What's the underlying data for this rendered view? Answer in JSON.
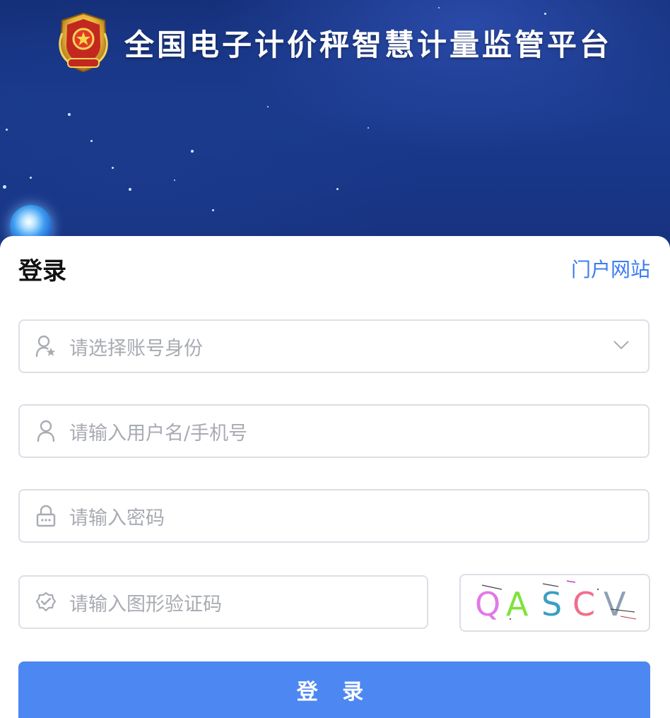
{
  "header": {
    "title": "全国电子计价秤智慧计量监管平台",
    "emblem_icon": "police-emblem-icon"
  },
  "login": {
    "title": "登录",
    "portal_link": "门户网站",
    "identity_select": {
      "placeholder": "请选择账号身份",
      "icon": "user-star-icon"
    },
    "username_field": {
      "placeholder": "请输入用户名/手机号",
      "icon": "user-icon"
    },
    "password_field": {
      "placeholder": "请输入密码",
      "icon": "lock-icon"
    },
    "captcha_field": {
      "placeholder": "请输入图形验证码",
      "icon": "verified-shield-icon"
    },
    "captcha_image": {
      "text": "QASCV",
      "chars": [
        "Q",
        "A",
        "S",
        "C",
        "V"
      ]
    },
    "submit_label": "登 录"
  },
  "colors": {
    "primary": "#4d87f1",
    "link": "#3c7cf0",
    "hero_background": "#1a3a8e",
    "border": "#dcdfe6",
    "placeholder": "#a8abb2"
  }
}
